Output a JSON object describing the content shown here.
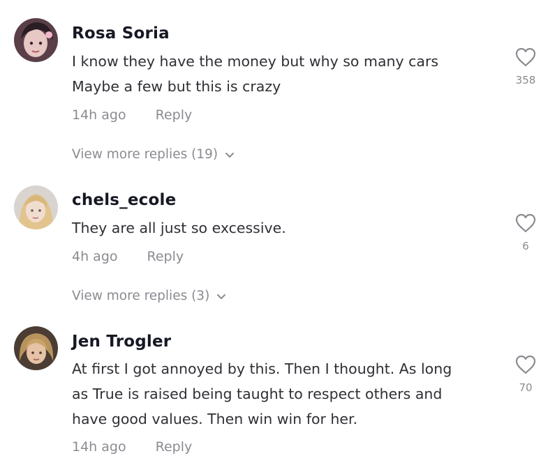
{
  "comments": [
    {
      "username": "Rosa Soria",
      "lines": [
        "I know they have the money but why so many cars",
        "Maybe a few but this is crazy"
      ],
      "time": "14h ago",
      "reply_label": "Reply",
      "likes": "358",
      "view_more": "View more replies (19)"
    },
    {
      "username": "chels_ecole",
      "lines": [
        "They are all just so excessive."
      ],
      "time": "4h ago",
      "reply_label": "Reply",
      "likes": "6",
      "view_more": "View more replies (3)"
    },
    {
      "username": "Jen Trogler",
      "lines": [
        "At first I got annoyed by this. Then I thought. As long",
        "as True is raised being taught to respect others and",
        "have good values. Then win win for her."
      ],
      "time": "14h ago",
      "reply_label": "Reply",
      "likes": "70"
    }
  ],
  "icons": {
    "like": "heart-outline-icon",
    "expand": "chevron-down-icon"
  },
  "colors": {
    "username": "#161823",
    "body_text": "#2f2f35",
    "secondary_text": "#8a8b91"
  }
}
